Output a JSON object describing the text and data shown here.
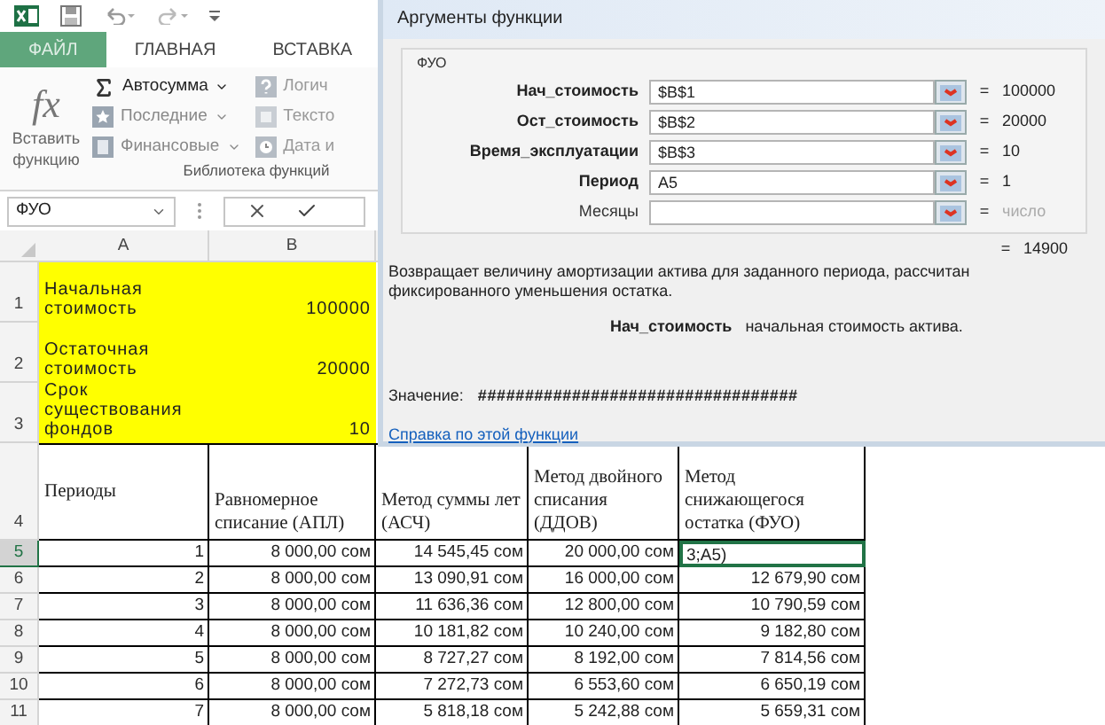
{
  "ribbon": {
    "tabs": [
      {
        "label": "ФАЙЛ",
        "kind": "file"
      },
      {
        "label": "ГЛАВНАЯ",
        "kind": "tab"
      },
      {
        "label": "ВСТАВКА",
        "kind": "tab"
      }
    ],
    "fx_symbol": "fx",
    "insert_function": [
      "Вставить",
      "функцию"
    ],
    "commands": [
      {
        "label": "Автосумма",
        "kind": "sum",
        "dropdown": true
      },
      {
        "label": "Последние",
        "kind": "recent",
        "dropdown": true
      },
      {
        "label": "Финансовые",
        "kind": "financial",
        "dropdown": true
      }
    ],
    "commands_2": [
      {
        "label": "Логич",
        "kind": "logical"
      },
      {
        "label": "Тексто",
        "kind": "text"
      },
      {
        "label": "Дата и",
        "kind": "date"
      }
    ],
    "group_label": "Библиотека функций"
  },
  "formula_bar": {
    "name_box": "ФУО"
  },
  "sheet": {
    "columns": [
      "A",
      "B"
    ],
    "info_rows": [
      {
        "row": "1",
        "label": "Начальная стоимость",
        "value": "100000"
      },
      {
        "row": "2",
        "label": "Остаточная стоимость",
        "value": "20000"
      },
      {
        "row": "3",
        "label": "Срок существования фондов",
        "value": "10"
      }
    ],
    "header_row": {
      "row": "4",
      "cells": [
        "Периоды",
        "Равномерное списание (АПЛ)",
        "Метод суммы лет (АСЧ)",
        "Метод двойного списания (ДДОВ)",
        "Метод снижающегося остатка  (ФУО)"
      ]
    },
    "rows": [
      {
        "row": "5",
        "selected": true,
        "cells": [
          "1",
          "8 000,00 сом",
          "14 545,45 сом",
          "20 000,00 сом",
          "3;A5)"
        ]
      },
      {
        "row": "6",
        "selected": false,
        "cells": [
          "2",
          "8 000,00 сом",
          "13 090,91 сом",
          "16 000,00 сом",
          "12 679,90 сом"
        ]
      },
      {
        "row": "7",
        "selected": false,
        "cells": [
          "3",
          "8 000,00 сом",
          "11 636,36 сом",
          "12 800,00 сом",
          "10 790,59 сом"
        ]
      },
      {
        "row": "8",
        "selected": false,
        "cells": [
          "4",
          "8 000,00 сом",
          "10 181,82 сом",
          "10 240,00 сом",
          "9 182,80 сом"
        ]
      },
      {
        "row": "9",
        "selected": false,
        "cells": [
          "5",
          "8 000,00 сом",
          "8 727,27 сом",
          "8 192,00 сом",
          "7 814,56 сом"
        ]
      },
      {
        "row": "10",
        "selected": false,
        "cells": [
          "6",
          "8 000,00 сом",
          "7 272,73 сом",
          "6 553,60 сом",
          "6 650,19 сом"
        ]
      },
      {
        "row": "11",
        "selected": false,
        "cells": [
          "7",
          "8 000,00 сом",
          "5 818,18 сом",
          "5 242,88 сом",
          "5 659,31 сом"
        ]
      }
    ]
  },
  "dialog": {
    "title": "Аргументы функции",
    "function": "ФУО",
    "arguments": [
      {
        "label": "Нач_стоимость",
        "required": true,
        "value": "$B$1",
        "result": "100000",
        "placeholder_result": false
      },
      {
        "label": "Ост_стоимость",
        "required": true,
        "value": "$B$2",
        "result": "20000",
        "placeholder_result": false
      },
      {
        "label": "Время_эксплуатации",
        "required": true,
        "value": "$B$3",
        "result": "10",
        "placeholder_result": false
      },
      {
        "label": "Период",
        "required": true,
        "value": "A5",
        "result": "1",
        "placeholder_result": false
      },
      {
        "label": "Месяцы",
        "required": false,
        "result": "число",
        "placeholder_result": true
      }
    ],
    "equals": "=",
    "total": "14900",
    "description": [
      "Возвращает величину амортизации актива для заданного периода, рассчитан",
      "фиксированного уменьшения остатка."
    ],
    "argument_help": "**Нач_стоимость**   начальная стоимость актива.",
    "value_label": "Значение:",
    "value": "##################################",
    "help_link": "Справка по этой функции"
  }
}
